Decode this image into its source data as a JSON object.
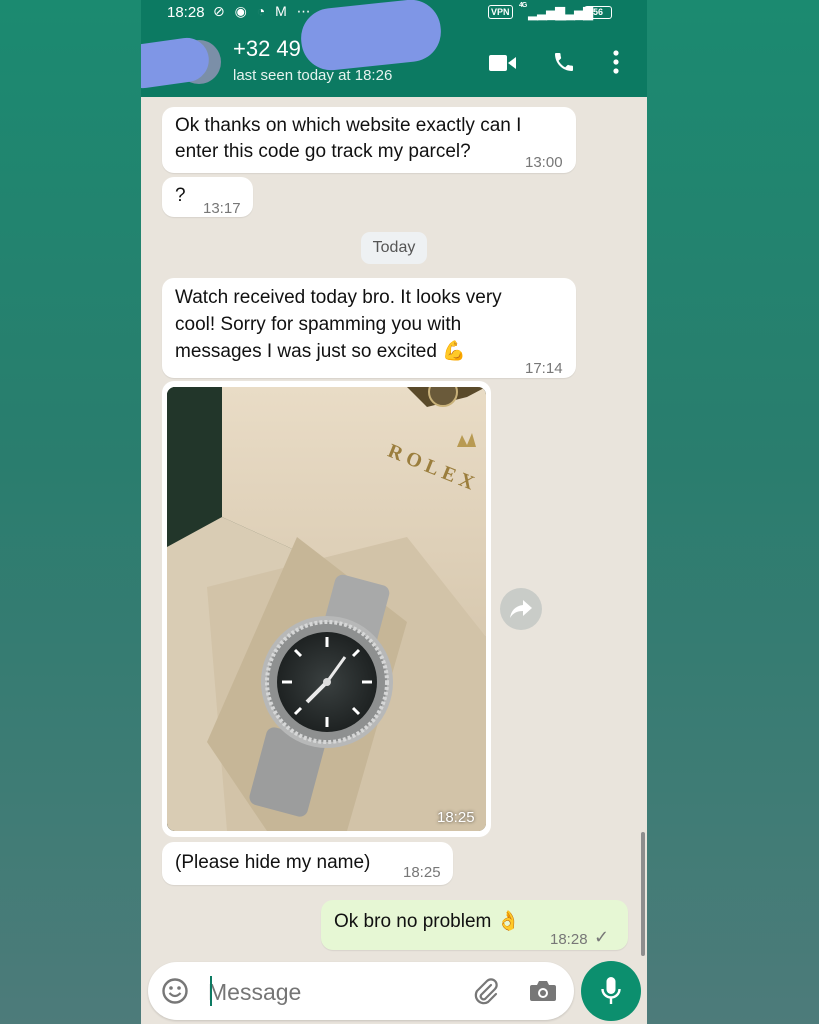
{
  "status_bar": {
    "time": "18:28",
    "notification_icons": [
      "mute-bell-icon",
      "whatsapp-icon",
      "sync-icon",
      "gmail-icon",
      "more-dots-icon"
    ],
    "notif_glyphs": "⊘ ◉ ◔ M ⋯",
    "vpn": "VPN",
    "network": "4G",
    "battery": "56"
  },
  "header": {
    "contact": "+32 49",
    "last_seen": "last seen today at 18:26",
    "accent": "#0c7a62"
  },
  "messages": [
    {
      "text": "Ok thanks on which website exactly can I\nenter this code go track my parcel?",
      "time": "13:00"
    },
    {
      "text": "?",
      "time": "13:17"
    },
    {
      "text": "Watch received today bro. It looks very\ncool! Sorry for spamming you with\nmessages I was just so excited 💪",
      "time": "17:14"
    },
    {
      "text": "(Please hide my name)",
      "time": "18:25"
    }
  ],
  "date_separator": "Today",
  "image_message": {
    "brand": "ROLEX",
    "crown": "♛",
    "time": "18:25"
  },
  "outgoing": {
    "text": "Ok bro no problem 👌",
    "time": "18:28",
    "status": "✓"
  },
  "composer": {
    "placeholder": "Message"
  },
  "colors": {
    "incoming_bubble": "#ffffff",
    "outgoing_bubble": "#e6f7d4",
    "chat_bg": "#e9e4dc",
    "redaction": "#7f96e6"
  }
}
